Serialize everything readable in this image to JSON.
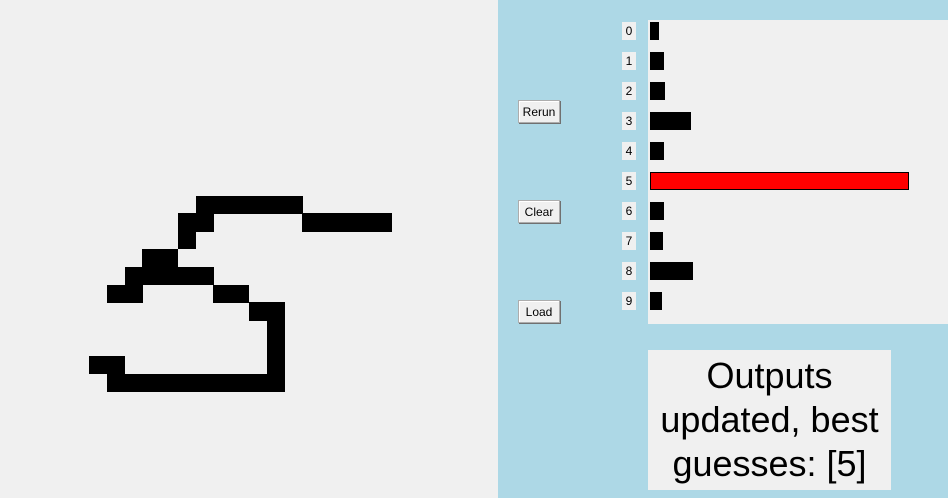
{
  "buttons": {
    "rerun": "Rerun",
    "clear": "Clear",
    "load": "Load"
  },
  "chart_data": {
    "type": "bar",
    "orientation": "horizontal",
    "categories": [
      "0",
      "1",
      "2",
      "3",
      "4",
      "5",
      "6",
      "7",
      "8",
      "9"
    ],
    "values": [
      0.035,
      0.054,
      0.058,
      0.158,
      0.054,
      1.0,
      0.054,
      0.05,
      0.166,
      0.046
    ],
    "highlight_index": 5,
    "colors": {
      "bar": "#000000",
      "highlight": "#ff0000"
    }
  },
  "status": {
    "text": "Outputs updated, best guesses: [5]"
  },
  "drawing": {
    "grid_size": 28,
    "filled_cells": [
      [
        11,
        11
      ],
      [
        12,
        11
      ],
      [
        13,
        11
      ],
      [
        14,
        11
      ],
      [
        15,
        11
      ],
      [
        16,
        11
      ],
      [
        10,
        12
      ],
      [
        11,
        12
      ],
      [
        17,
        12
      ],
      [
        18,
        12
      ],
      [
        19,
        12
      ],
      [
        20,
        12
      ],
      [
        21,
        12
      ],
      [
        10,
        13
      ],
      [
        8,
        14
      ],
      [
        9,
        14
      ],
      [
        7,
        15
      ],
      [
        8,
        15
      ],
      [
        9,
        15
      ],
      [
        10,
        15
      ],
      [
        11,
        15
      ],
      [
        6,
        16
      ],
      [
        7,
        16
      ],
      [
        12,
        16
      ],
      [
        13,
        16
      ],
      [
        14,
        17
      ],
      [
        15,
        17
      ],
      [
        15,
        18
      ],
      [
        15,
        19
      ],
      [
        5,
        20
      ],
      [
        6,
        20
      ],
      [
        15,
        20
      ],
      [
        6,
        21
      ],
      [
        7,
        21
      ],
      [
        8,
        21
      ],
      [
        9,
        21
      ],
      [
        10,
        21
      ],
      [
        11,
        21
      ],
      [
        12,
        21
      ],
      [
        13,
        21
      ],
      [
        14,
        21
      ],
      [
        15,
        21
      ]
    ]
  },
  "colors": {
    "panel": "#add8e6",
    "canvas": "#f0f0f0"
  }
}
